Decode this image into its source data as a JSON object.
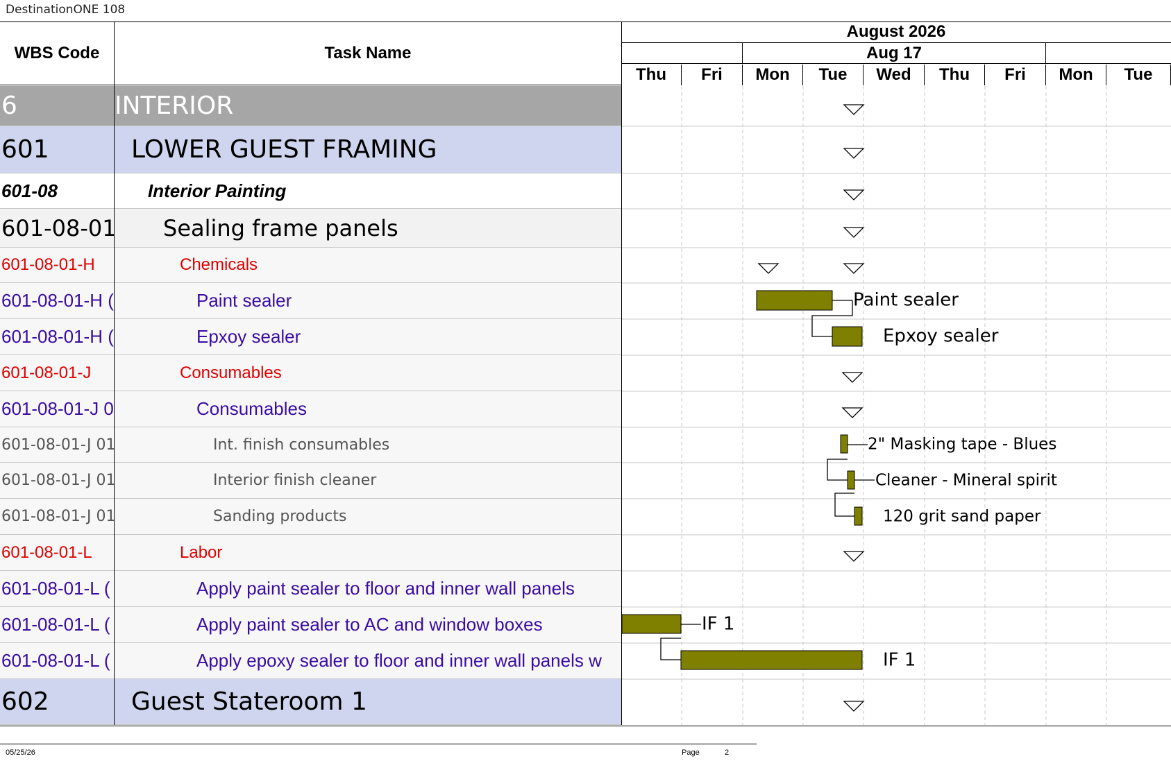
{
  "document": {
    "title": "DestinationONE 108"
  },
  "columns": {
    "wbs": "WBS Code",
    "task": "Task Name"
  },
  "timescale": {
    "month": "August 2026",
    "week": "Aug 17",
    "days": [
      "Thu",
      "Fri",
      "Mon",
      "Tue",
      "Wed",
      "Thu",
      "Fri",
      "Mon",
      "Tue"
    ]
  },
  "rows": [
    {
      "wbs": "6",
      "task": "INTERIOR",
      "level": "phase"
    },
    {
      "wbs": "601",
      "task": "LOWER GUEST FRAMING",
      "level": "area"
    },
    {
      "wbs": "601-08",
      "task": "Interior Painting",
      "level": "group"
    },
    {
      "wbs": "601-08-01",
      "task": "Sealing frame panels",
      "level": "summary"
    },
    {
      "wbs": "601-08-01-H",
      "task": "Chemicals",
      "level": "category"
    },
    {
      "wbs": "601-08-01-H (",
      "task": "Paint sealer",
      "level": "item"
    },
    {
      "wbs": "601-08-01-H (",
      "task": "Epxoy sealer",
      "level": "item"
    },
    {
      "wbs": "601-08-01-J",
      "task": "Consumables",
      "level": "category"
    },
    {
      "wbs": "601-08-01-J 0",
      "task": "Consumables",
      "level": "item"
    },
    {
      "wbs": "601-08-01-J 01",
      "task": "Int. finish consumables",
      "level": "detail"
    },
    {
      "wbs": "601-08-01-J 01",
      "task": "Interior finish cleaner",
      "level": "detail"
    },
    {
      "wbs": "601-08-01-J 01",
      "task": "Sanding products",
      "level": "detail"
    },
    {
      "wbs": "601-08-01-L",
      "task": "Labor",
      "level": "category"
    },
    {
      "wbs": "601-08-01-L (",
      "task": "Apply paint sealer to floor and inner wall panels",
      "level": "item"
    },
    {
      "wbs": "601-08-01-L (",
      "task": "Apply paint sealer to AC and window boxes",
      "level": "item"
    },
    {
      "wbs": "601-08-01-L (",
      "task": "Apply epoxy sealer to floor and inner wall panels w",
      "level": "item"
    },
    {
      "wbs": "602",
      "task": "Guest Stateroom 1",
      "level": "area"
    }
  ],
  "bar_labels": {
    "paint_sealer": "Paint sealer",
    "epoxy_sealer": "Epxoy sealer",
    "masking_tape": "2\" Masking tape - Blues",
    "cleaner": "Cleaner - Mineral spirit",
    "sand_paper": "120 grit sand paper",
    "if1_a": "IF 1",
    "if1_b": "IF 1"
  },
  "colors": {
    "bar": "#808000",
    "phase_bg": "#a6a6a6",
    "area_bg": "#cfd5ee",
    "category_text": "#e00000",
    "item_text": "#3a0ca3",
    "detail_text": "#555555"
  },
  "footer": {
    "date": "05/25/26",
    "page_label": "Page",
    "page_number": "2"
  }
}
